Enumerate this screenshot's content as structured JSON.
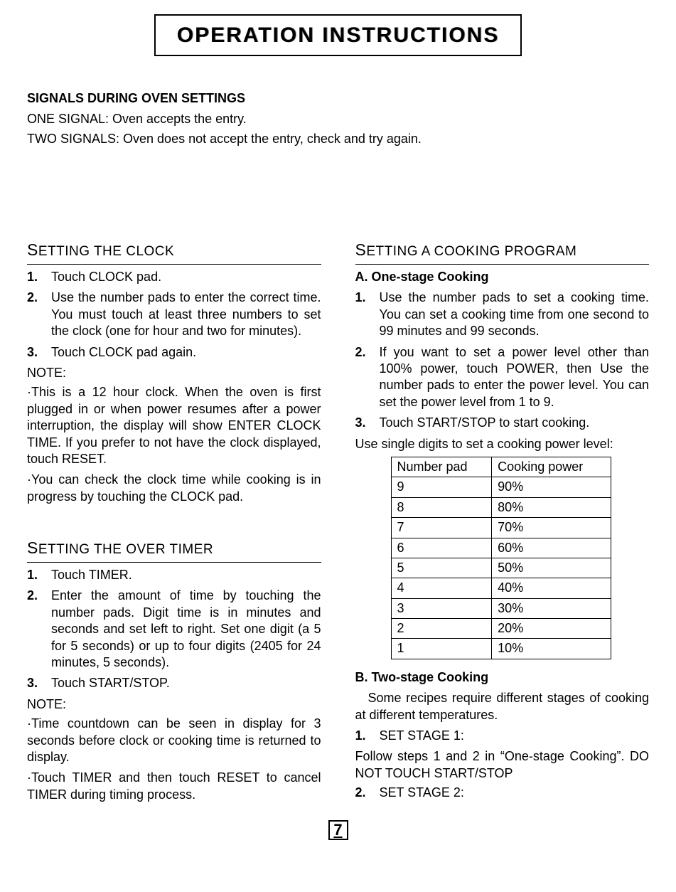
{
  "title": "OPERATION INSTRUCTIONS",
  "intro": {
    "heading": "SIGNALS DURING OVEN SETTINGS",
    "line1": "ONE SIGNAL: Oven accepts the entry.",
    "line2": "TWO SIGNALS: Oven does not accept the entry, check and try again."
  },
  "clock": {
    "heading_cap": "S",
    "heading_rest": "ETTING THE CLOCK",
    "step1": "Touch CLOCK pad.",
    "step2": "Use the number pads to enter the correct time. You must touch at least three numbers to set the clock (one for hour and two for minutes).",
    "step3": "Touch CLOCK pad again.",
    "note_label": "NOTE:",
    "note1": "·This is a 12 hour clock. When the oven is first plugged in or when power resumes after a power interruption, the display will show ENTER CLOCK TIME. If you prefer to not have the clock displayed, touch RESET.",
    "note2": "·You can check the clock time while cooking is in progress by touching the CLOCK pad."
  },
  "timer": {
    "heading_cap": "S",
    "heading_rest": "ETTING THE OVER TIMER",
    "step1": "Touch TIMER.",
    "step2": "Enter the amount of time by touching the number pads. Digit time is in minutes and seconds and set left to right. Set one digit (a 5 for 5 seconds) or up to four digits (2405 for 24 minutes, 5 seconds).",
    "step3": "Touch START/STOP.",
    "note_label": "NOTE:",
    "note1": "·Time countdown can be seen in display for 3 seconds before clock or cooking time is returned to display.",
    "note2": "·Touch TIMER and then touch RESET to cancel TIMER during timing process."
  },
  "cook": {
    "heading_cap": "S",
    "heading_rest": "ETTING A COOKING PROGRAM",
    "a_title": "A. One-stage Cooking",
    "a_step1": "Use the number pads to set a cooking time. You can set a cooking time from one second to 99 minutes and 99 seconds.",
    "a_step2": "If you want to set a power level other than 100% power, touch POWER, then Use the number pads to enter the power level. You can set the power level from 1 to 9.",
    "a_step3": "Touch START/STOP to start cooking.",
    "use_digits": "Use single digits to set a cooking power level:",
    "th1": "Number pad",
    "th2": "Cooking power",
    "r": [
      {
        "n": "9",
        "p": "90%"
      },
      {
        "n": "8",
        "p": "80%"
      },
      {
        "n": "7",
        "p": "70%"
      },
      {
        "n": "6",
        "p": "60%"
      },
      {
        "n": "5",
        "p": "50%"
      },
      {
        "n": "4",
        "p": "40%"
      },
      {
        "n": "3",
        "p": "30%"
      },
      {
        "n": "2",
        "p": "20%"
      },
      {
        "n": "1",
        "p": "10%"
      }
    ],
    "b_title": "B. Two-stage Cooking",
    "b_intro": " Some recipes require different stages of cooking at different temperatures.",
    "b_step1": "SET STAGE 1:",
    "b_follow1": "Follow steps 1 and 2 in “One-stage Cooking”. DO NOT TOUCH START/STOP",
    "b_step2": "SET STAGE 2:"
  },
  "labels": {
    "s1": "1.",
    "s2": "2.",
    "s3": "3."
  },
  "page_number": "7"
}
